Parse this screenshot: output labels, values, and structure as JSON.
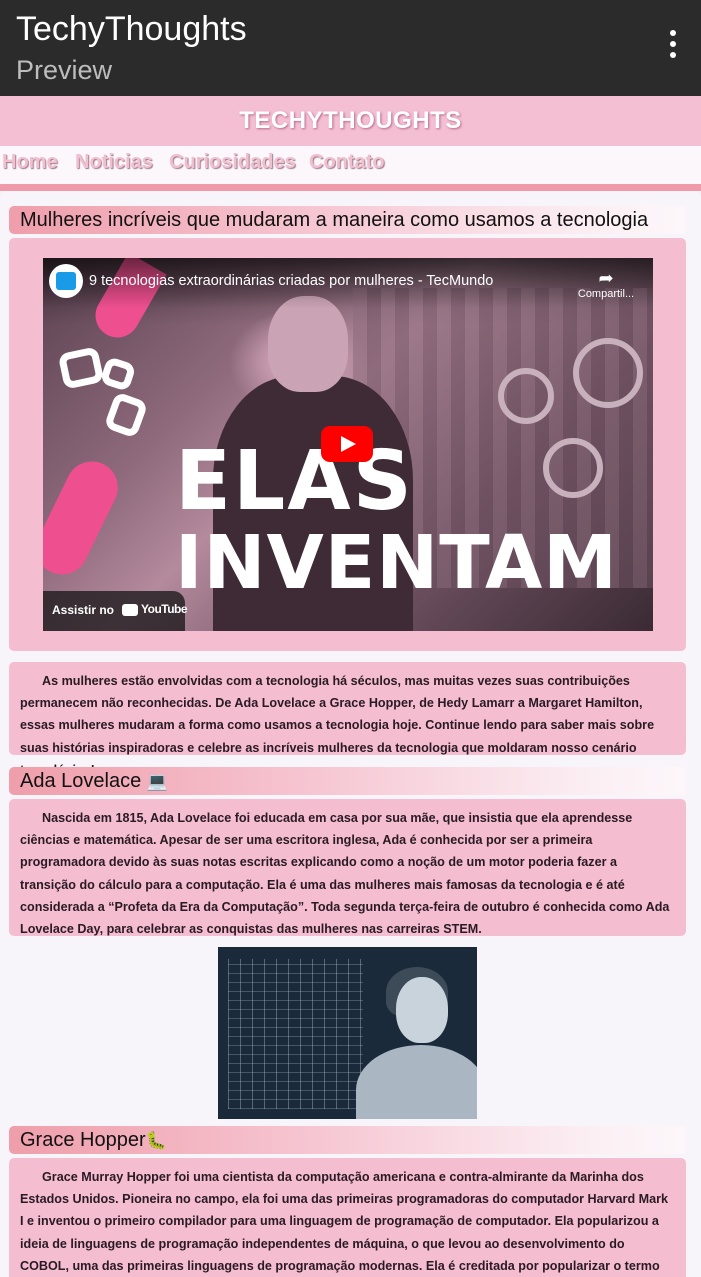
{
  "app_bar": {
    "title": "TechyThoughts",
    "subtitle": "Preview",
    "menu_icon": "more-vert-icon"
  },
  "site": {
    "brand": "TECHYTHOUGHTS",
    "nav": [
      "Home",
      "Noticias",
      "Curiosidades",
      "Contato"
    ]
  },
  "article": {
    "title": "Mulheres incríveis que mudaram a maneira como usamos a tecnologia",
    "video": {
      "title": "9 tecnologias extraordinárias criadas por mulheres - TecMundo",
      "share_label": "Compartil...",
      "overlay_line1": "ELAS",
      "overlay_line2": "INVENTAM",
      "watch_label": "Assistir no",
      "youtube_label": "YouTube"
    },
    "intro": "As mulheres estão envolvidas com a tecnologia há séculos, mas muitas vezes suas contribuições permanecem não reconhecidas. De Ada Lovelace a Grace Hopper, de Hedy Lamarr a Margaret Hamilton, essas mulheres mudaram a forma como usamos a tecnologia hoje. Continue lendo para saber mais sobre suas histórias inspiradoras e celebre as incríveis mulheres da tecnologia que moldaram nosso cenário tecnológico!",
    "sections": [
      {
        "heading": "Ada Lovelace",
        "emoji": "💻",
        "text": "Nascida em 1815, Ada Lovelace foi educada em casa por sua mãe, que insistia que ela aprendesse ciências e matemática. Apesar de ser uma escritora inglesa, Ada é conhecida por ser a primeira programadora devido às suas notas escritas explicando como a noção de um motor poderia fazer a transição do cálculo para a computação. Ela é uma das mulheres mais famosas da tecnologia e é até considerada a “Profeta da Era da Computação”. Toda segunda terça-feira de outubro é conhecida como Ada Lovelace Day, para celebrar as conquistas das mulheres nas carreiras STEM."
      },
      {
        "heading": "Grace Hopper",
        "emoji": "🐛",
        "text": "Grace Murray Hopper foi uma cientista da computação americana e contra-almirante da Marinha dos Estados Unidos. Pioneira no campo, ela foi uma das primeiras programadoras do computador Harvard Mark I e inventou o primeiro compilador para uma linguagem de programação de computador. Ela popularizou a ideia de linguagens de programação independentes de máquina, o que levou ao desenvolvimento do COBOL, uma das primeiras linguagens de programação modernas. Ela é creditada por popularizar o termo \"debugging\""
      }
    ]
  },
  "colors": {
    "app_bar": "#2b2b2b",
    "header_pink": "#f4bfd2",
    "nav_rule": "#ee9aab",
    "box_pink": "#f4bdd0",
    "youtube_red": "#ff0000"
  }
}
